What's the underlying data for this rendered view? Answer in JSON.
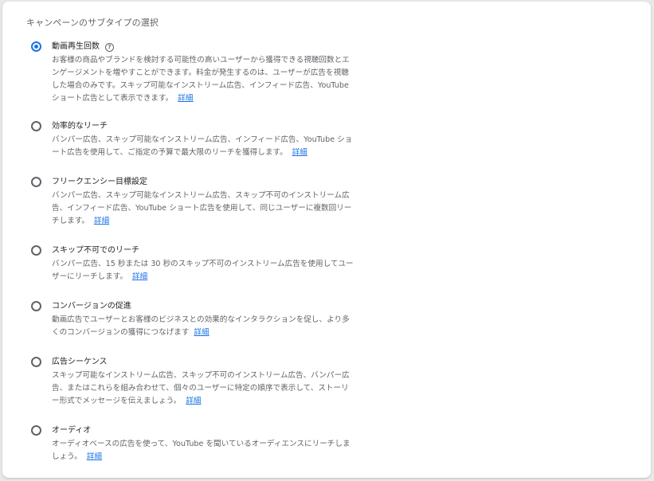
{
  "section": {
    "title": "キャンペーンのサブタイプの選択"
  },
  "colors": {
    "accent": "#1a73e8",
    "text_primary": "#202124",
    "text_secondary": "#5f6368"
  },
  "options": [
    {
      "title": "動画再生回数",
      "selected": true,
      "has_help_icon": true,
      "help_icon": "?",
      "description": "お客様の商品やブランドを検討する可能性の高いユーザーから獲得できる視聴回数とエンゲージメントを増やすことができます。料金が発生するのは、ユーザーが広告を視聴した場合のみです。スキップ可能なインストリーム広告、インフィード広告、YouTube ショート広告として表示できます。",
      "link": "詳細"
    },
    {
      "title": "効率的なリーチ",
      "selected": false,
      "description": "バンパー広告、スキップ可能なインストリーム広告、インフィード広告、YouTube ショート広告を使用して、ご指定の予算で最大限のリーチを獲得します。",
      "link": "詳細"
    },
    {
      "title": "フリークエンシー目標設定",
      "selected": false,
      "description": "バンパー広告、スキップ可能なインストリーム広告、スキップ不可のインストリーム広告、インフィード広告、YouTube ショート広告を使用して、同じユーザーに複数回リーチします。",
      "link": "詳細"
    },
    {
      "title": "スキップ不可でのリーチ",
      "selected": false,
      "description": "バンパー広告、15 秒または 30 秒のスキップ不可のインストリーム広告を使用してユーザーにリーチします。",
      "link": "詳細"
    },
    {
      "title": "コンバージョンの促進",
      "selected": false,
      "description": "動画広告でユーザーとお客様のビジネスとの効果的なインタラクションを促し、より多くのコンバージョンの獲得につなげます",
      "link": "詳細"
    },
    {
      "title": "広告シーケンス",
      "selected": false,
      "description": "スキップ可能なインストリーム広告、スキップ不可のインストリーム広告、バンパー広告、またはこれらを組み合わせて、個々のユーザーに特定の順序で表示して、ストーリー形式でメッセージを伝えましょう。",
      "link": "詳細"
    },
    {
      "title": "オーディオ",
      "selected": false,
      "description": "オーディオベースの広告を使って、YouTube を聞いているオーディエンスにリーチしましょう。",
      "link": "詳細"
    }
  ]
}
